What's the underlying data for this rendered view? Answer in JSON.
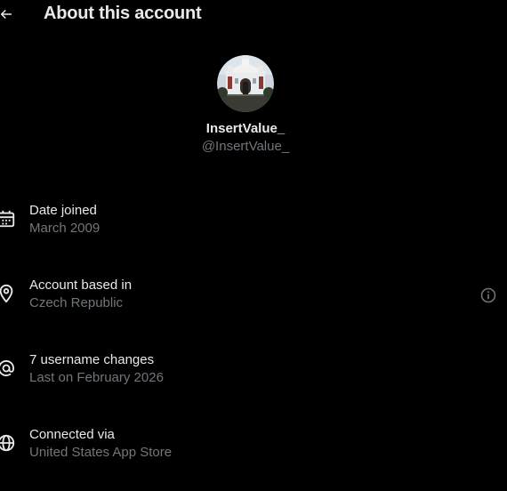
{
  "header": {
    "title": "About this account",
    "back_icon": "arrow-left-icon"
  },
  "profile": {
    "display_name": "InsertValue_",
    "handle": "@InsertValue_"
  },
  "rows": [
    {
      "icon": "calendar-icon",
      "label": "Date joined",
      "value": "March 2009"
    },
    {
      "icon": "location-pin-icon",
      "label": "Account based in",
      "value": "Czech Republic",
      "trailing_icon": "info-icon"
    },
    {
      "icon": "at-sign-icon",
      "label": "7 username changes",
      "value": "Last on February 2026"
    },
    {
      "icon": "globe-icon",
      "label": "Connected via",
      "value": "United States App Store"
    }
  ],
  "colors": {
    "background": "#000000",
    "primary_text": "#e7e9ea",
    "secondary_text": "#71767b"
  }
}
